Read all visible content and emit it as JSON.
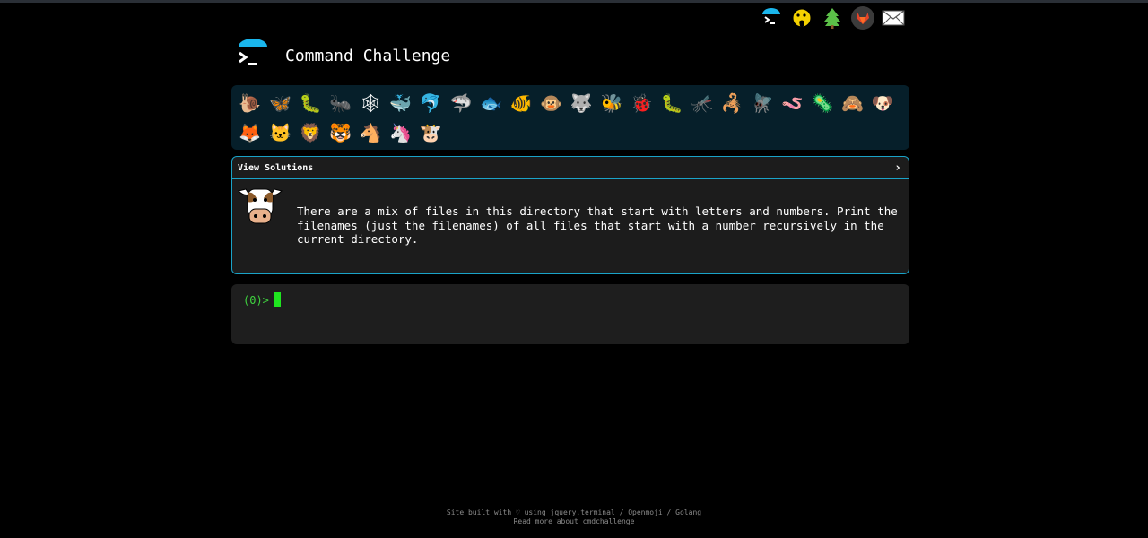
{
  "app": {
    "title": "Command Challenge"
  },
  "top_icons": [
    {
      "name": "cmdchallenge-logo-icon"
    },
    {
      "name": "yellow-face-icon"
    },
    {
      "name": "tree-icon"
    },
    {
      "name": "gitlab-icon"
    },
    {
      "name": "envelope-icon"
    }
  ],
  "challenges": [
    {
      "emoji": "🐌",
      "name": "snail"
    },
    {
      "emoji": "🦋",
      "name": "butterfly"
    },
    {
      "emoji": "🐛",
      "name": "caterpillar"
    },
    {
      "emoji": "🐜",
      "name": "ant"
    },
    {
      "emoji": "🕸",
      "name": "spider-web"
    },
    {
      "emoji": "🐳",
      "name": "whale"
    },
    {
      "emoji": "🐬",
      "name": "dolphin"
    },
    {
      "emoji": "🦈",
      "name": "shark"
    },
    {
      "emoji": "🐟",
      "name": "fish"
    },
    {
      "emoji": "🐠",
      "name": "tropical-fish"
    },
    {
      "emoji": "🐵",
      "name": "monkey-face"
    },
    {
      "emoji": "🐺",
      "name": "wolf"
    },
    {
      "emoji": "🐝",
      "name": "bee"
    },
    {
      "emoji": "🐞",
      "name": "ladybug"
    },
    {
      "emoji": "🐛",
      "name": "worm"
    },
    {
      "emoji": "🦟",
      "name": "mosquito"
    },
    {
      "emoji": "🦂",
      "name": "scorpion"
    },
    {
      "emoji": "🪰",
      "name": "fly"
    },
    {
      "emoji": "🪱",
      "name": "earthworm"
    },
    {
      "emoji": "🦠",
      "name": "microbe"
    },
    {
      "emoji": "🙈",
      "name": "monkey"
    },
    {
      "emoji": "🐶",
      "name": "dog"
    },
    {
      "emoji": "🦊",
      "name": "fox"
    },
    {
      "emoji": "🐱",
      "name": "cat"
    },
    {
      "emoji": "🦁",
      "name": "lion"
    },
    {
      "emoji": "🐯",
      "name": "tiger"
    },
    {
      "emoji": "🐴",
      "name": "horse"
    },
    {
      "emoji": "🦄",
      "name": "unicorn"
    },
    {
      "emoji": "🐮",
      "name": "cow"
    }
  ],
  "challenge": {
    "view_solutions_label": "View Solutions",
    "chevron": "›",
    "description": "There are a mix of files in this directory that start with letters and numbers. Print the filenames (just the filenames) of all files that start with a number recursively in the current directory."
  },
  "terminal": {
    "prompt": "(0)>"
  },
  "footer": {
    "line1": "Site built with ♡ using jquery.terminal / Openmoji / Golang",
    "line2": "Read more about cmdchallenge"
  },
  "colors": {
    "accent": "#1aa3c8",
    "emoji_bar_bg": "#061f2a",
    "card_bg": "#1c1c1c",
    "prompt": "#3fd43f",
    "cursor": "#1fe51f"
  }
}
